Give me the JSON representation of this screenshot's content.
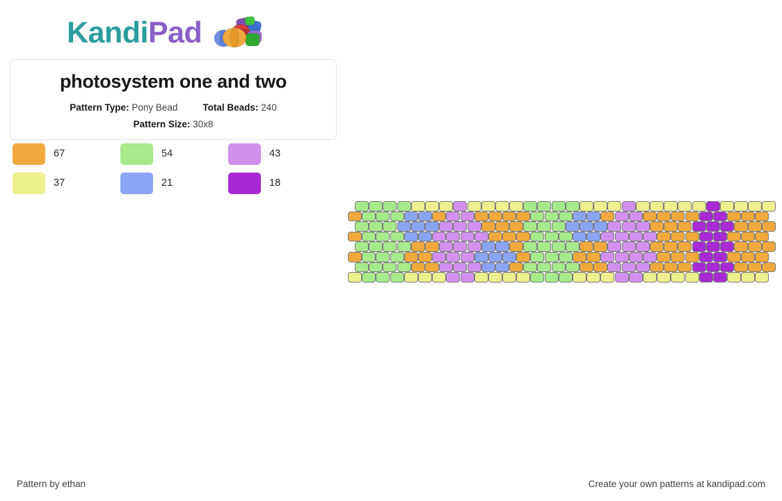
{
  "logo": {
    "part1": "Kandi",
    "part2": "Pad",
    "color1": "#2a9d9c",
    "color2": "#8a5fc8",
    "beads_icon": "bead-cluster-icon"
  },
  "info": {
    "title": "photosystem one and two",
    "pattern_type_label": "Pattern Type:",
    "pattern_type_value": "Pony Bead",
    "total_beads_label": "Total Beads:",
    "total_beads_value": "240",
    "pattern_size_label": "Pattern Size:",
    "pattern_size_value": "30x8"
  },
  "legend": [
    {
      "key": "O",
      "color": "#f0a93c",
      "count": "67",
      "name": "orange"
    },
    {
      "key": "G",
      "color": "#a7e98b",
      "count": "54",
      "name": "light-green"
    },
    {
      "key": "P",
      "color": "#d190ee",
      "count": "43",
      "name": "light-purple"
    },
    {
      "key": "Y",
      "color": "#eeef8e",
      "count": "37",
      "name": "light-yellow"
    },
    {
      "key": "B",
      "color": "#8ba5f4",
      "count": "21",
      "name": "blue"
    },
    {
      "key": "V",
      "color": "#a82ad4",
      "count": "18",
      "name": "dark-purple"
    }
  ],
  "palette": {
    "O": "#f0a93c",
    "G": "#a7e98b",
    "P": "#d190ee",
    "Y": "#eeef8e",
    "B": "#8ba5f4",
    "V": "#a82ad4"
  },
  "pattern": {
    "type": "Pony Bead",
    "width": 30,
    "height": 8,
    "total_beads": 240,
    "stitch": "brick-offset",
    "rows": [
      {
        "offset": true,
        "beads": [
          "G",
          "G",
          "G",
          "G",
          "Y",
          "Y",
          "Y",
          "P",
          "Y",
          "Y",
          "Y",
          "Y",
          "G",
          "G",
          "G",
          "G",
          "Y",
          "Y",
          "Y",
          "P",
          "Y",
          "Y",
          "Y",
          "Y",
          "Y",
          "V",
          "Y",
          "Y",
          "Y",
          "Y"
        ]
      },
      {
        "offset": false,
        "beads": [
          "O",
          "G",
          "G",
          "G",
          "B",
          "B",
          "O",
          "P",
          "P",
          "O",
          "O",
          "O",
          "O",
          "G",
          "G",
          "G",
          "B",
          "B",
          "O",
          "P",
          "P",
          "O",
          "O",
          "O",
          "O",
          "V",
          "V",
          "O",
          "O",
          "O"
        ]
      },
      {
        "offset": true,
        "beads": [
          "G",
          "G",
          "G",
          "B",
          "B",
          "B",
          "P",
          "P",
          "P",
          "O",
          "O",
          "O",
          "G",
          "G",
          "G",
          "B",
          "B",
          "B",
          "P",
          "P",
          "P",
          "O",
          "O",
          "O",
          "V",
          "V",
          "V",
          "O",
          "O",
          "O"
        ]
      },
      {
        "offset": false,
        "beads": [
          "O",
          "G",
          "G",
          "G",
          "B",
          "B",
          "P",
          "P",
          "P",
          "P",
          "O",
          "O",
          "O",
          "G",
          "G",
          "G",
          "B",
          "B",
          "P",
          "P",
          "P",
          "P",
          "O",
          "O",
          "O",
          "V",
          "V",
          "O",
          "O",
          "O"
        ]
      },
      {
        "offset": true,
        "beads": [
          "G",
          "G",
          "G",
          "G",
          "O",
          "O",
          "P",
          "P",
          "P",
          "B",
          "B",
          "O",
          "G",
          "G",
          "G",
          "G",
          "O",
          "O",
          "P",
          "P",
          "P",
          "O",
          "O",
          "O",
          "V",
          "V",
          "V",
          "O",
          "O",
          "O"
        ]
      },
      {
        "offset": false,
        "beads": [
          "O",
          "G",
          "G",
          "G",
          "O",
          "O",
          "P",
          "P",
          "P",
          "B",
          "B",
          "B",
          "O",
          "G",
          "G",
          "G",
          "O",
          "O",
          "P",
          "P",
          "P",
          "P",
          "O",
          "O",
          "O",
          "V",
          "V",
          "O",
          "O",
          "O"
        ]
      },
      {
        "offset": true,
        "beads": [
          "G",
          "G",
          "G",
          "G",
          "O",
          "O",
          "P",
          "P",
          "P",
          "B",
          "B",
          "O",
          "G",
          "G",
          "G",
          "G",
          "O",
          "O",
          "P",
          "P",
          "P",
          "O",
          "O",
          "O",
          "V",
          "V",
          "V",
          "O",
          "O",
          "O"
        ]
      },
      {
        "offset": false,
        "beads": [
          "Y",
          "G",
          "G",
          "G",
          "Y",
          "Y",
          "Y",
          "P",
          "P",
          "Y",
          "Y",
          "Y",
          "Y",
          "G",
          "G",
          "G",
          "Y",
          "Y",
          "Y",
          "P",
          "P",
          "Y",
          "Y",
          "Y",
          "Y",
          "V",
          "V",
          "Y",
          "Y",
          "Y"
        ]
      }
    ]
  },
  "footer": {
    "credit": "Pattern by ethan",
    "promo": "Create your own patterns at kandipad.com"
  }
}
